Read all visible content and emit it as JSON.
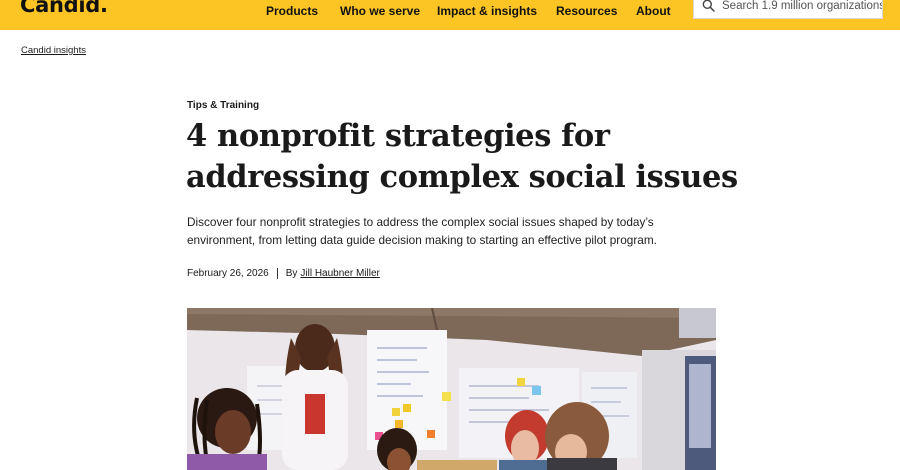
{
  "header": {
    "logo_text": "Candid.",
    "nav": [
      "Products",
      "Who we serve",
      "Impact & insights",
      "Resources",
      "About"
    ],
    "search_placeholder": "Search 1.9 million organizations",
    "brand_color": "#fdc524"
  },
  "breadcrumb": "Candid insights",
  "article": {
    "category": "Tips & Training",
    "title_line1": "4 nonprofit strategies for",
    "title_line2": "addressing complex social issues",
    "summary_line1": "Discover four nonprofit strategies to address the complex social issues shaped by today’s",
    "summary_line2": "environment, from letting data guide decision making to starting an effective pilot program.",
    "date": "February 26, 2026",
    "by": "By",
    "author": "Jill Haubner Miller"
  }
}
